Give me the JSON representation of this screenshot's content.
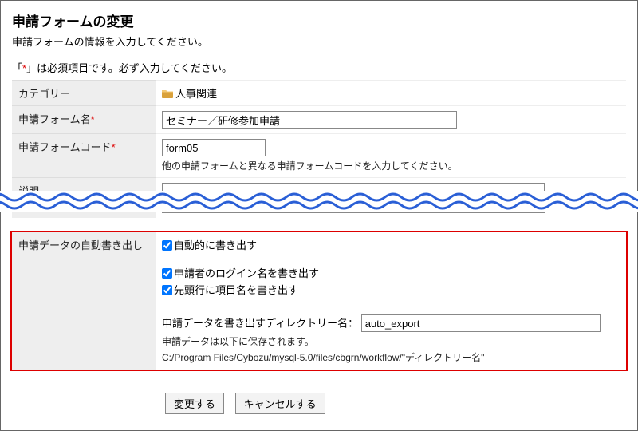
{
  "header": {
    "title": "申請フォームの変更",
    "subtitle": "申請フォームの情報を入力してください。",
    "required_note_pre": "「",
    "required_note_mid": "」は必須項目です。必ず入力してください。",
    "asterisk": "*"
  },
  "rows": {
    "category": {
      "label": "カテゴリー",
      "value": "人事関連"
    },
    "name": {
      "label": "申請フォーム名",
      "value": "セミナー／研修参加申請"
    },
    "code": {
      "label": "申請フォームコード",
      "value": "form05",
      "help": "他の申請フォームと異なる申請フォームコードを入力してください。"
    },
    "desc": {
      "label": "説明"
    },
    "export": {
      "label": "申請データの自動書き出し",
      "opt_auto": "自動的に書き出す",
      "opt_login": "申請者のログイン名を書き出す",
      "opt_header": "先頭行に項目名を書き出す",
      "dir_label": "申請データを書き出すディレクトリー名：",
      "dir_value": "auto_export",
      "saved_note": "申請データは以下に保存されます。",
      "path": "C:/Program Files/Cybozu/mysql-5.0/files/cbgrn/workflow/\"ディレクトリー名\""
    }
  },
  "buttons": {
    "submit": "変更する",
    "cancel": "キャンセルする"
  }
}
